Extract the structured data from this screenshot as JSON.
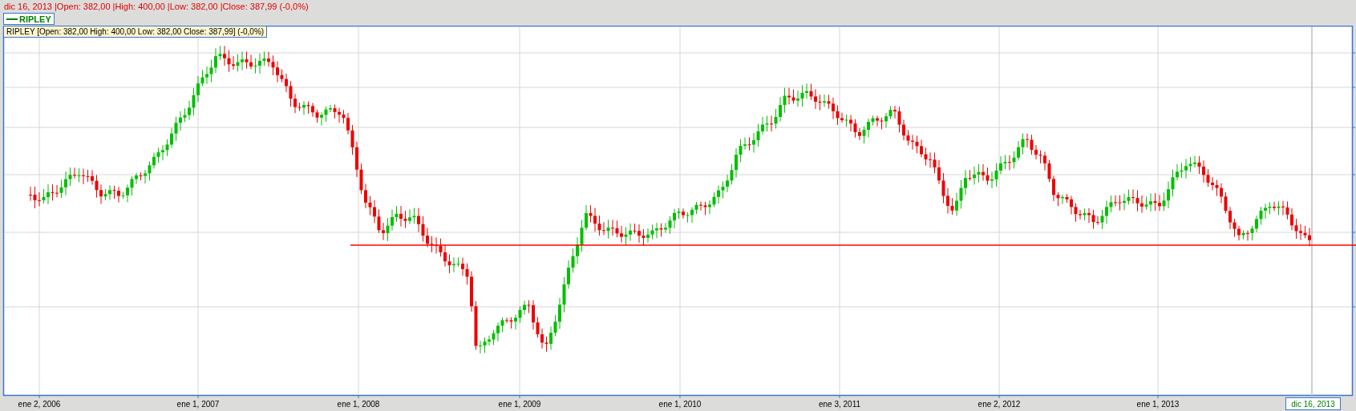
{
  "header": {
    "summary": "dic 16, 2013 |Open: 382,00 |High: 400,00 |Low: 382,00 |Close: 387,99 (-0,0%)"
  },
  "legend": {
    "label": "RIPLEY",
    "color": "#008000"
  },
  "tooltip": {
    "text": "RIPLEY [Open: 382,00  High: 400,00  Low: 382,00  Close: 387,99] (-0,0%)"
  },
  "x_axis": {
    "labels": [
      "ene 2, 2006",
      "ene 1, 2007",
      "ene 1, 2008",
      "ene 1, 2009",
      "ene 1, 2010",
      "ene 3, 2011",
      "ene 2, 2012",
      "ene 1, 2013"
    ]
  },
  "cursor": {
    "date": "dic 16, 2013"
  }
}
